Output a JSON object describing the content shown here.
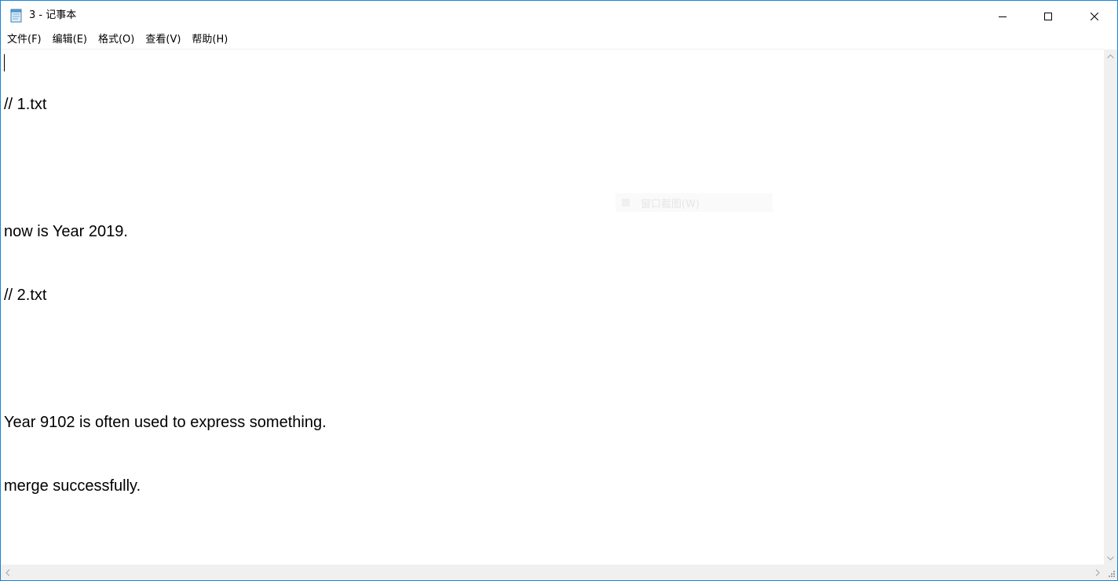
{
  "window": {
    "title": "3 - 记事本",
    "icons": {
      "app": "notepad-icon",
      "minimize": "minimize-icon",
      "maximize": "maximize-icon",
      "close": "close-icon"
    },
    "accent_color": "#1883d7"
  },
  "menu": {
    "items": [
      {
        "label": "文件(F)"
      },
      {
        "label": "编辑(E)"
      },
      {
        "label": "格式(O)"
      },
      {
        "label": "查看(V)"
      },
      {
        "label": "帮助(H)"
      }
    ]
  },
  "editor": {
    "lines": [
      "// 1.txt",
      "",
      "now is Year 2019.",
      "// 2.txt",
      "",
      "Year 9102 is often used to express something.",
      "merge successfully."
    ]
  },
  "overlay": {
    "ghost_tooltip_label": "窗口截图(W)"
  },
  "scrollbars": {
    "icons": {
      "up": "chevron-up-icon",
      "down": "chevron-down-icon",
      "left": "chevron-left-icon",
      "right": "chevron-right-icon",
      "grip": "size-grip-icon"
    }
  }
}
